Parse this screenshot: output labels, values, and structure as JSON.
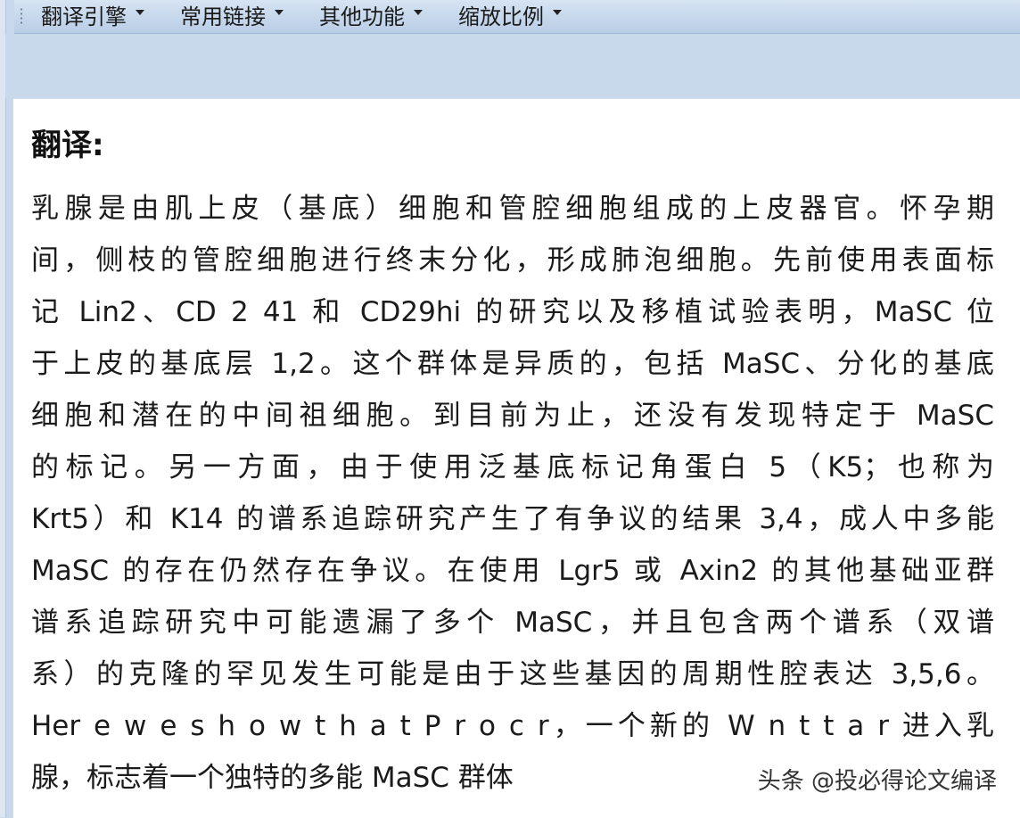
{
  "menubar": {
    "items": [
      {
        "label": "翻译引擎"
      },
      {
        "label": "常用链接"
      },
      {
        "label": "其他功能"
      },
      {
        "label": "缩放比例"
      }
    ]
  },
  "content": {
    "heading": "翻译:",
    "lines": [
      "乳腺是由肌上皮（基底）细胞和管腔细胞组成的上皮器官。怀孕期",
      "间，侧枝的管腔细胞进行终末分化，形成肺泡细胞。先前使用表面标",
      "记 Lin2、CD 2 41 和 CD29hi 的研究以及移植试验表明，MaSC 位",
      "于上皮的基底层 1,2。这个群体是异质的，包括 MaSC、分化的基底",
      "细胞和潜在的中间祖细胞。到目前为止，还没有发现特定于 MaSC",
      "的标记。另一方面，由于使用泛基底标记角蛋白 5（K5；也称为",
      "Krt5）和 K14 的谱系追踪研究产生了有争议的结果 3,4，成人中多能",
      "MaSC 的存在仍然存在争议。在使用 Lgr5 或 Axin2 的其他基础亚群",
      "谱系追踪研究中可能遗漏了多个 MaSC，并且包含两个谱系（双谱",
      "系）的克隆的罕见发生可能是由于这些基因的周期性腔表达 3,5,6。",
      "Her e w e s h o w t h a t P r o c r，一个新的 W n t t a r 进入乳",
      "腺，标志着一个独特的多能 MaSC 群体"
    ]
  },
  "watermark": "头条 @投必得论文编译"
}
